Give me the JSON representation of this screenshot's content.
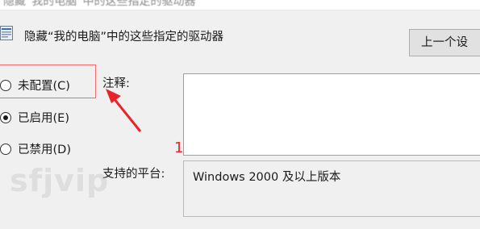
{
  "window": {
    "blurred_title": "隐藏“我的电脑”中的这些指定的驱动器"
  },
  "policy": {
    "title": "隐藏“我的电脑”中的这些指定的驱动器",
    "icon": "policy-icon"
  },
  "nav": {
    "prev_label": "上一个设"
  },
  "state_options": [
    {
      "label": "未配置(C)",
      "checked": false
    },
    {
      "label": "已启用(E)",
      "checked": true
    },
    {
      "label": "已禁用(D)",
      "checked": false
    }
  ],
  "comment": {
    "label": "注释:",
    "value": ""
  },
  "supported_on": {
    "label": "支持的平台:",
    "value": "Windows 2000 及以上版本"
  },
  "annotation": {
    "number": "1",
    "color": "#e8242a"
  },
  "watermark": "sfjvip"
}
